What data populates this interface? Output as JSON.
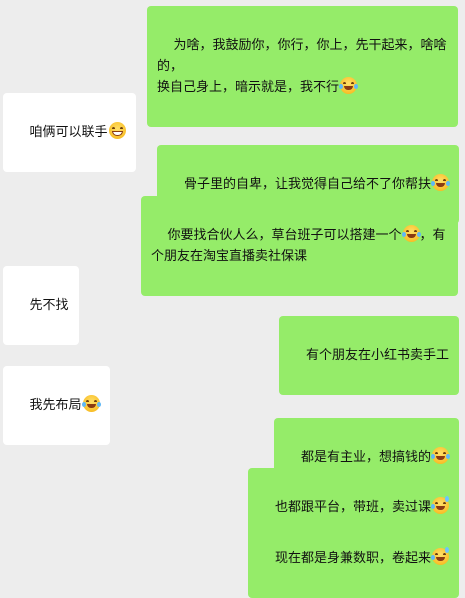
{
  "messages": [
    {
      "side": "mine",
      "text": "为啥，我鼓励你，你行，你上，先干起来，啥啥的，\n换自己身上，暗示就是，我不行",
      "emoji": "tears-of-joy-emoji"
    },
    {
      "side": "theirs",
      "text": "咱俩可以联手",
      "emoji": "grin-emoji"
    },
    {
      "side": "mine",
      "text": "骨子里的自卑，让我觉得自己给不了你帮扶",
      "emoji": "tears-of-joy-emoji"
    },
    {
      "side": "mine",
      "text": "你要找合伙人么，草台班子可以搭建一个",
      "emoji": "tears-of-joy-emoji",
      "text2": "，有\n个朋友在淘宝直播卖社保课"
    },
    {
      "side": "theirs",
      "text": "先不找",
      "emoji": ""
    },
    {
      "side": "mine",
      "text": "有个朋友在小红书卖手工",
      "emoji": ""
    },
    {
      "side": "theirs",
      "text": "我先布局",
      "emoji": "tears-of-joy-emoji"
    },
    {
      "side": "mine",
      "text": "都是有主业，想搞钱的",
      "emoji": "tears-of-joy-emoji"
    },
    {
      "side": "mine",
      "text": "也都跟平台，带班，卖过课",
      "emoji": "rolling-laugh-emoji"
    },
    {
      "side": "mine",
      "text": "现在都是身兼数职，卷起来",
      "emoji": "rolling-laugh-emoji"
    }
  ]
}
